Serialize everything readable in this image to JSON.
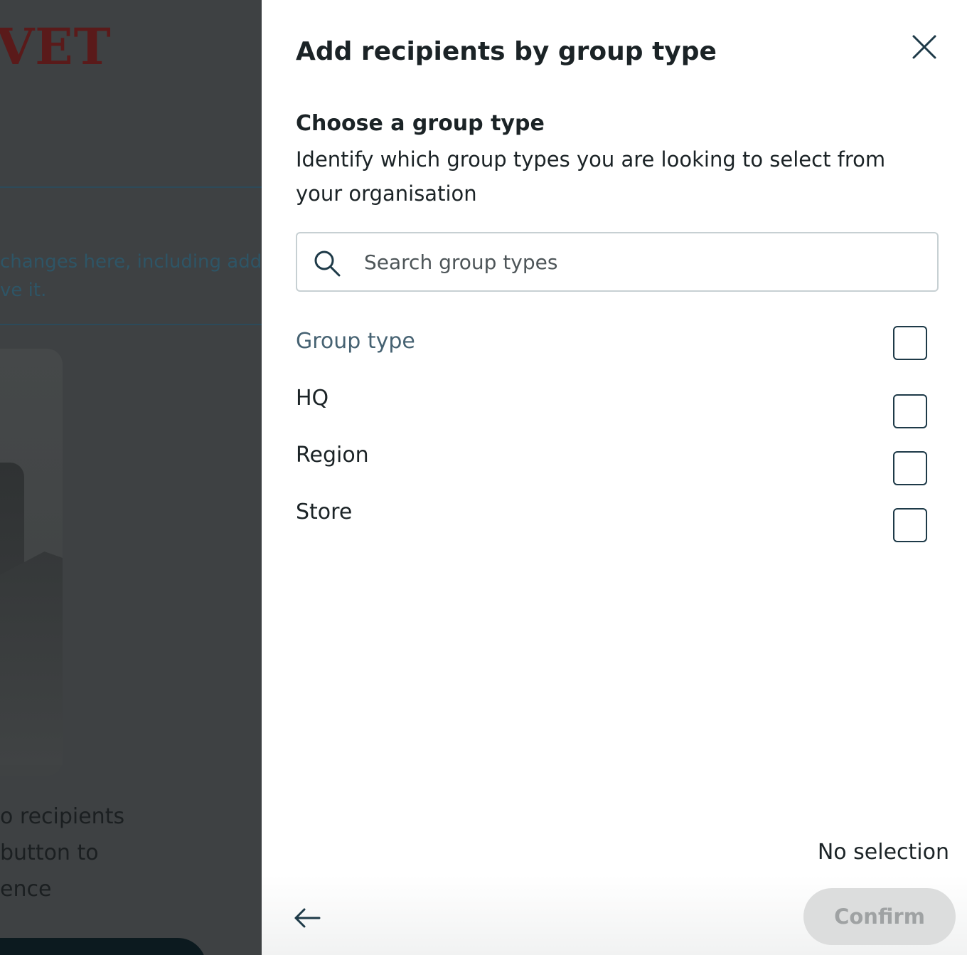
{
  "background": {
    "logo_text": "VET",
    "notice_lines": [
      "changes here, including addi",
      "ve it."
    ],
    "body_lines": [
      "o recipients",
      "button to",
      "ence"
    ]
  },
  "drawer": {
    "title": "Add recipients by group type",
    "close_icon": "close-icon",
    "section_title": "Choose a group type",
    "section_description": "Identify which group types you are looking to select from your organisation",
    "search": {
      "placeholder": "Search group types",
      "value": "",
      "icon": "search-icon"
    },
    "list": {
      "header_label": "Group type",
      "items": [
        {
          "label": "HQ",
          "checked": false
        },
        {
          "label": "Region",
          "checked": false
        },
        {
          "label": "Store",
          "checked": false
        }
      ]
    },
    "selection_status": "No selection",
    "footer": {
      "back_icon": "arrow-left-icon",
      "confirm_label": "Confirm"
    }
  },
  "colors": {
    "overlay": "#3e4143",
    "heading": "#1b2326",
    "muted_header": "#466272",
    "checkbox_border": "#1e3a48",
    "disabled_button_bg": "#dcdddd",
    "disabled_button_text": "#9fa2a3"
  }
}
